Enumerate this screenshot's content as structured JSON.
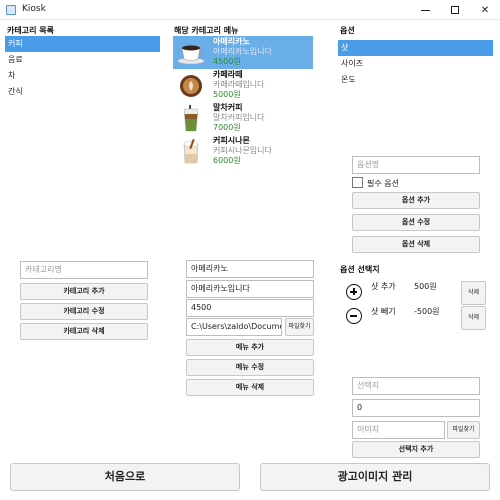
{
  "window": {
    "title": "Kiosk"
  },
  "category": {
    "header": "카테고리 목록",
    "items": [
      {
        "label": "커피",
        "selected": true
      },
      {
        "label": "음료",
        "selected": false
      },
      {
        "label": "차",
        "selected": false
      },
      {
        "label": "간식",
        "selected": false
      }
    ],
    "name_placeholder": "카테고리명",
    "add_label": "카테고리 추가",
    "edit_label": "카테고리 수정",
    "delete_label": "카테고리 삭제"
  },
  "menu": {
    "header": "해당 카테고리 메뉴",
    "items": [
      {
        "name": "아메리카노",
        "desc": "아메리카노입니다",
        "price": "4500원",
        "icon": "americano-icon",
        "selected": true
      },
      {
        "name": "카페라떼",
        "desc": "카페라떼입니다",
        "price": "5000원",
        "icon": "latte-icon",
        "selected": false
      },
      {
        "name": "말차커피",
        "desc": "말차커피입니다",
        "price": "7000원",
        "icon": "matcha-icon",
        "selected": false
      },
      {
        "name": "커피시나몬",
        "desc": "커피시나몬입니다",
        "price": "6000원",
        "icon": "cinnamon-icon",
        "selected": false
      }
    ],
    "form": {
      "name_value": "아메리카노",
      "desc_value": "아메리카노입니다",
      "price_value": "4500",
      "image_path": "C:\\Users\\zaldo\\Document",
      "find_file_label": "파일찾기"
    },
    "add_label": "메뉴 추가",
    "edit_label": "메뉴 수정",
    "delete_label": "메뉴 삭제"
  },
  "option": {
    "header": "옵션",
    "items": [
      {
        "label": "샷",
        "selected": true
      },
      {
        "label": "사이즈",
        "selected": false
      },
      {
        "label": "온도",
        "selected": false
      }
    ],
    "name_placeholder": "옵션명",
    "required_label": "필수 옵션",
    "add_label": "옵션 추가",
    "edit_label": "옵션 수정",
    "delete_label": "옵션 삭제"
  },
  "choice": {
    "header": "옵션 선택지",
    "items": [
      {
        "label": "샷 추가",
        "price": "500원",
        "icon": "plus-circle-icon",
        "button": "삭제"
      },
      {
        "label": "샷 빼기",
        "price": "-500원",
        "icon": "minus-circle-icon",
        "button": "삭제"
      }
    ],
    "name_placeholder": "선택지",
    "price_value": "0",
    "image_placeholder": "이미지",
    "find_file_label": "파일찾기",
    "add_label": "선택지 추가"
  },
  "footer": {
    "home_label": "처음으로",
    "ad_label": "광고이미지 관리"
  },
  "colors": {
    "selected_bg": "#4a9ce8",
    "price_green": "#2e8b2e"
  }
}
